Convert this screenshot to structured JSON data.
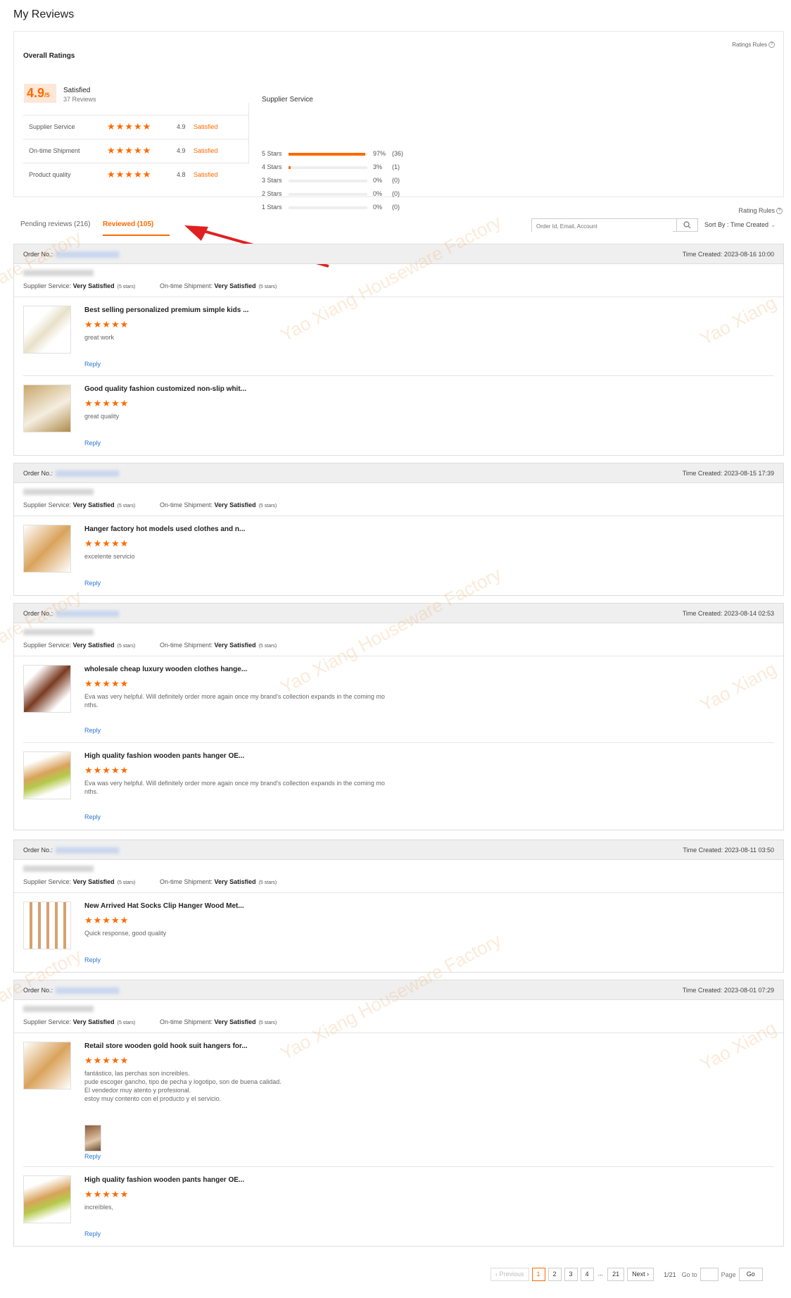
{
  "page": {
    "title": "My Reviews"
  },
  "overall": {
    "label": "Overall Ratings",
    "ratings_rules": "Ratings Rules",
    "score": "4.9",
    "score_suffix": "/5",
    "summary": "Satisfied",
    "reviews_count": "37 Reviews",
    "metrics": [
      {
        "label": "Supplier Service",
        "stars": "★★★★★",
        "value": "4.9",
        "status": "Satisfied"
      },
      {
        "label": "On-time Shipment",
        "stars": "★★★★★",
        "value": "4.9",
        "status": "Satisfied"
      },
      {
        "label": "Product quality",
        "stars": "★★★★★",
        "value": "4.8",
        "status": "Satisfied"
      }
    ],
    "supplier_service": {
      "title": "Supplier Service",
      "rows": [
        {
          "label": "5 Stars",
          "pct": "97%",
          "count": "(36)",
          "fraction": 0.97
        },
        {
          "label": "4 Stars",
          "pct": "3%",
          "count": "(1)",
          "fraction": 0.03
        },
        {
          "label": "3 Stars",
          "pct": "0%",
          "count": "(0)",
          "fraction": 0
        },
        {
          "label": "2 Stars",
          "pct": "0%",
          "count": "(0)",
          "fraction": 0
        },
        {
          "label": "1 Stars",
          "pct": "0%",
          "count": "(0)",
          "fraction": 0
        }
      ]
    }
  },
  "toolbar": {
    "rating_rules": "Rating Rules",
    "tab_pending": "Pending reviews (216)",
    "tab_reviewed": "Reviewed (105)",
    "search_placeholder": "Order Id, Email, Account",
    "sort_by": "Sort By : Time Created"
  },
  "orders": [
    {
      "order_no_label": "Order No.:",
      "time_created": "Time Created: 2023-08-16 10:00",
      "supplier_service_label": "Supplier Service:",
      "supplier_service_value": "Very Satisfied",
      "supplier_service_stars": "(5 stars)",
      "shipment_label": "On-time Shipment:",
      "shipment_value": "Very Satisfied",
      "shipment_stars": "(5 stars)",
      "items": [
        {
          "title": "Best selling personalized premium simple kids ...",
          "stars": "★★★★★",
          "text": "great work",
          "reply": "Reply"
        },
        {
          "title": "Good quality fashion customized non-slip whit...",
          "stars": "★★★★★",
          "text": "great quality",
          "reply": "Reply"
        }
      ]
    },
    {
      "order_no_label": "Order No.:",
      "time_created": "Time Created: 2023-08-15 17:39",
      "supplier_service_label": "Supplier Service:",
      "supplier_service_value": "Very Satisfied",
      "supplier_service_stars": "(5 stars)",
      "shipment_label": "On-time Shipment:",
      "shipment_value": "Very Satisfied",
      "shipment_stars": "(5 stars)",
      "items": [
        {
          "title": "Hanger factory hot models used clothes and n...",
          "stars": "★★★★★",
          "text": "excelente servicio",
          "reply": "Reply"
        }
      ]
    },
    {
      "order_no_label": "Order No.:",
      "time_created": "Time Created: 2023-08-14 02:53",
      "supplier_service_label": "Supplier Service:",
      "supplier_service_value": "Very Satisfied",
      "supplier_service_stars": "(5 stars)",
      "shipment_label": "On-time Shipment:",
      "shipment_value": "Very Satisfied",
      "shipment_stars": "(5 stars)",
      "items": [
        {
          "title": "wholesale cheap luxury wooden clothes hange...",
          "stars": "★★★★★",
          "text": "Eva was very helpful. Will definitely order more again once my brand's collection expands in the coming mo\nnths.",
          "reply": "Reply"
        },
        {
          "title": "High quality fashion wooden pants hanger OE...",
          "stars": "★★★★★",
          "text": "Eva was very helpful. Will definitely order more again once my brand's collection expands in the coming mo\nnths.",
          "reply": "Reply"
        }
      ]
    },
    {
      "order_no_label": "Order No.:",
      "time_created": "Time Created: 2023-08-11 03:50",
      "supplier_service_label": "Supplier Service:",
      "supplier_service_value": "Very Satisfied",
      "supplier_service_stars": "(5 stars)",
      "shipment_label": "On-time Shipment:",
      "shipment_value": "Very Satisfied",
      "shipment_stars": "(5 stars)",
      "items": [
        {
          "title": "New Arrived Hat Socks Clip Hanger Wood Met...",
          "stars": "★★★★★",
          "text": "Quick response, good quality",
          "reply": "Reply"
        }
      ]
    },
    {
      "order_no_label": "Order No.:",
      "time_created": "Time Created: 2023-08-01 07:29",
      "supplier_service_label": "Supplier Service:",
      "supplier_service_value": "Very Satisfied",
      "supplier_service_stars": "(5 stars)",
      "shipment_label": "On-time Shipment:",
      "shipment_value": "Very Satisfied",
      "shipment_stars": "(5 stars)",
      "items": [
        {
          "title": "Retail store wooden gold hook suit hangers for...",
          "stars": "★★★★★",
          "text": "fantástico, las perchas son increibles.\npude escoger gancho, tipo de pecha y logotipo, son de buena calidad.\nEl vendedor muy atento y profesional.\nestoy muy contento con el producto y el servicio.",
          "reply": "Reply"
        },
        {
          "title": "High quality fashion wooden pants hanger OE...",
          "stars": "★★★★★",
          "text": "increíbles,",
          "reply": "Reply"
        }
      ]
    }
  ],
  "pagination": {
    "prev": "Previous",
    "pages": [
      "1",
      "2",
      "3",
      "4",
      "...",
      "21"
    ],
    "next": "Next",
    "info": "1/21",
    "goto": "Go to",
    "page_label": "Page",
    "go": "Go"
  },
  "watermark": {
    "text_a": "Yao Xiang Houseware Factory",
    "text_b": "Yao Xiang",
    "text_c": "are Factory"
  },
  "colors": {
    "accent": "#ff6a00",
    "link": "#2a76d8",
    "arrow": "#e02020"
  }
}
